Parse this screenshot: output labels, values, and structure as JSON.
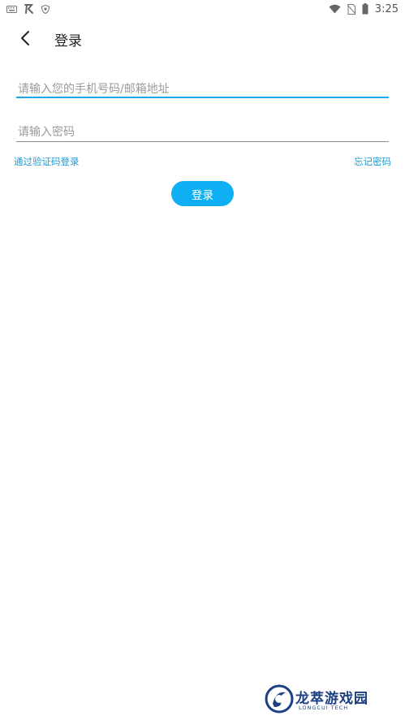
{
  "status_bar": {
    "time": "3:25",
    "left_icons": [
      "keyboard-icon",
      "app-logo-icon",
      "shield-icon"
    ],
    "right_icons": [
      "wifi-icon",
      "no-sim-icon",
      "battery-icon"
    ]
  },
  "header": {
    "title": "登录",
    "back_icon": "chevron-left-icon"
  },
  "form": {
    "account_placeholder": "请输入您的手机号码/邮箱地址",
    "account_value": "",
    "password_placeholder": "请输入密码",
    "password_value": "",
    "sms_login_link": "通过验证码登录",
    "forgot_password_link": "忘记密码",
    "submit_label": "登录"
  },
  "colors": {
    "accent": "#0fb0f3",
    "link": "#1e9ad6",
    "focused_underline": "#20a3e8",
    "underline": "#8a8a8a"
  },
  "watermark": {
    "name": "龙萃游戏园",
    "sub": "LONGCUI TECH"
  }
}
